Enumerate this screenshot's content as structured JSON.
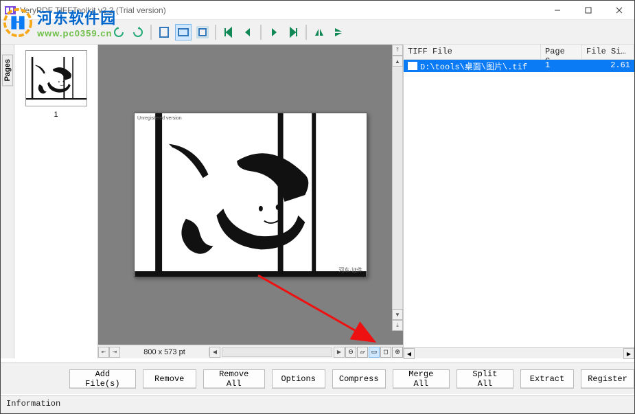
{
  "window": {
    "title": "VeryPDF TIFFToolkit v2.2 (Trial version)"
  },
  "watermark": {
    "name_cn": "河东软件园",
    "url": "www.pc0359.cn"
  },
  "pages_tab": {
    "label": "Pages"
  },
  "thumbnails": {
    "items": [
      {
        "label": "1"
      }
    ]
  },
  "viewer": {
    "unreg_text": "Unregistered version",
    "credit": "河东·证件",
    "dimensions": "800 x 573 pt"
  },
  "filelist": {
    "headers": {
      "file": "TIFF File",
      "pages": "Page C…",
      "size": "File Si…"
    },
    "rows": [
      {
        "path": "D:\\tools\\桌面\\图片\\.tif",
        "pages": "1",
        "size": "2.61"
      }
    ]
  },
  "buttons": {
    "add": "Add File(s)",
    "remove": "Remove",
    "remove_all": "Remove All",
    "options": "Options",
    "compress": "Compress",
    "merge": "Merge All",
    "split": "Split All",
    "extract": "Extract",
    "register": "Register"
  },
  "infobar": {
    "label": "Information"
  }
}
